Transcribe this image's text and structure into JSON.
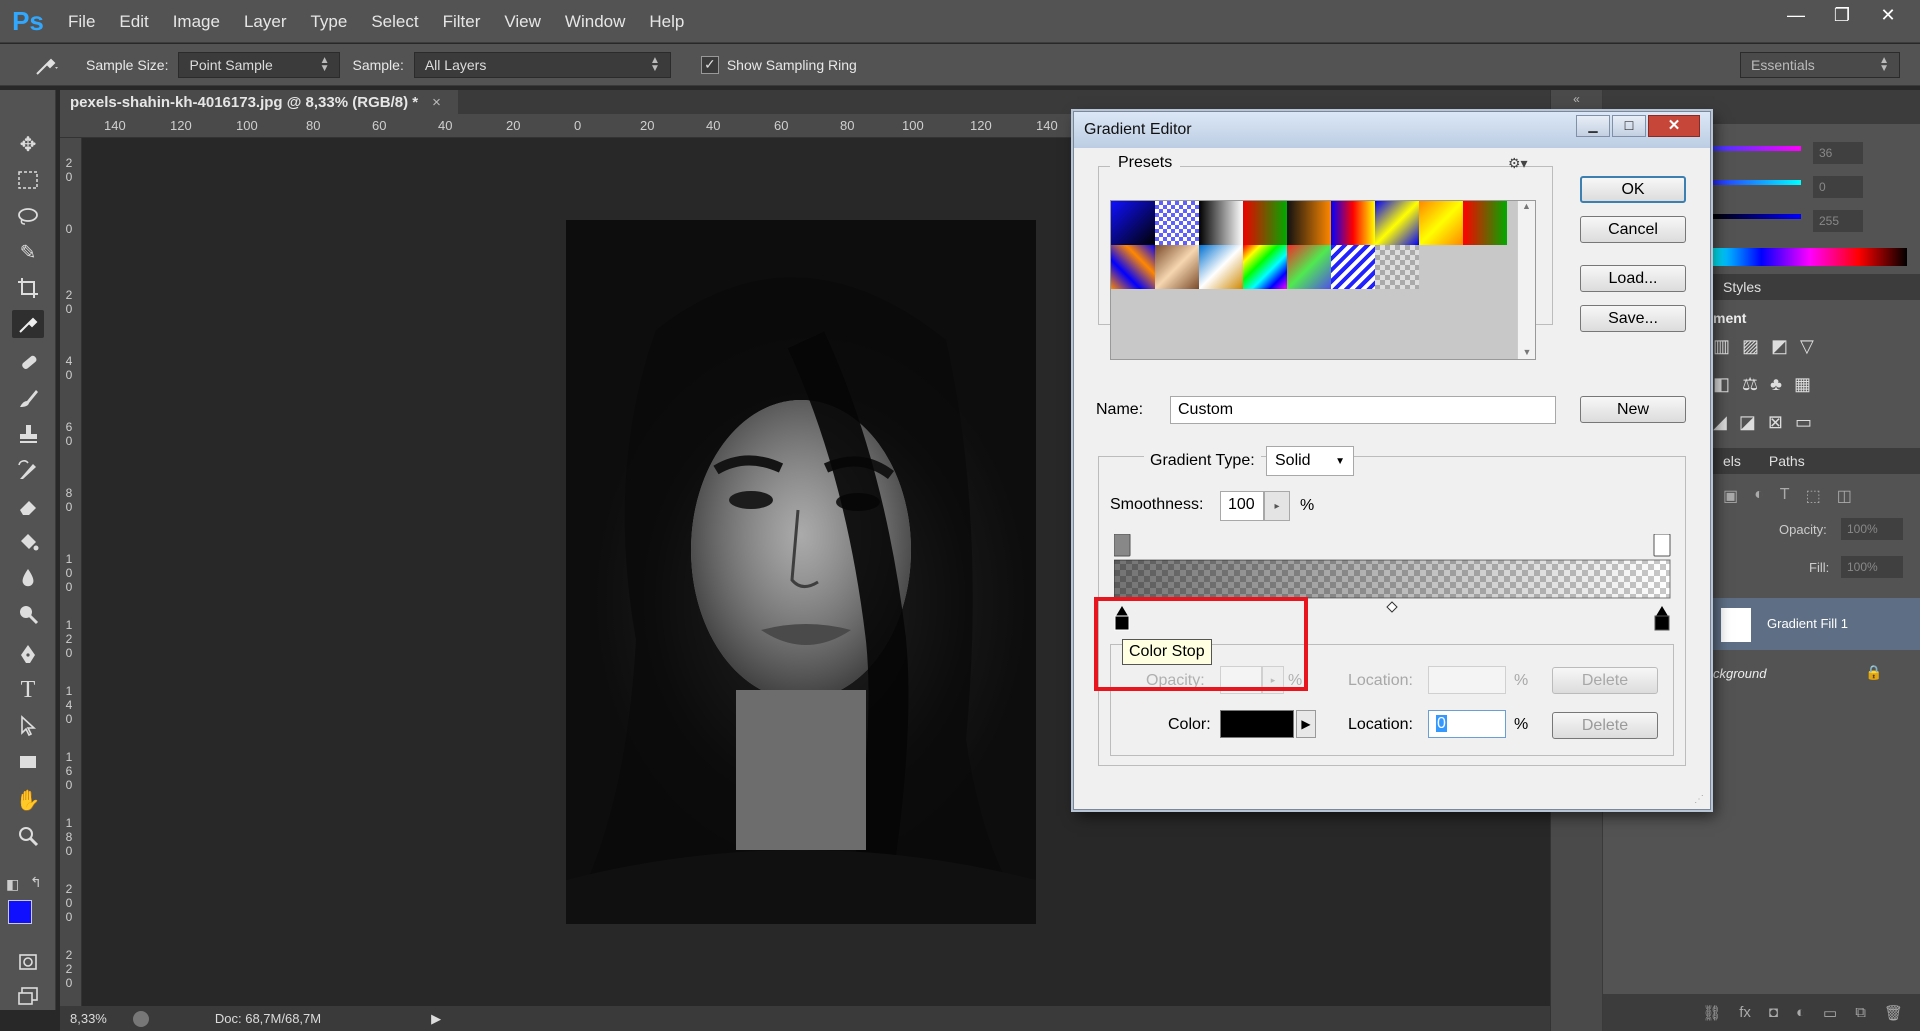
{
  "app": {
    "logo": "Ps"
  },
  "menu": [
    "File",
    "Edit",
    "Image",
    "Layer",
    "Type",
    "Select",
    "Filter",
    "View",
    "Window",
    "Help"
  ],
  "window_controls": {
    "minimize": "—",
    "restore": "❐",
    "close": "✕"
  },
  "options": {
    "sample_size_label": "Sample Size:",
    "sample_size_value": "Point Sample",
    "sample_label": "Sample:",
    "sample_value": "All Layers",
    "show_ring_label": "Show Sampling Ring",
    "show_ring_checked": true,
    "workspace": "Essentials"
  },
  "document": {
    "tab_title": "pexels-shahin-kh-4016173.jpg @ 8,33% (RGB/8) *",
    "tab_close": "×",
    "zoom": "8,33%",
    "doc_info": "Doc: 68,7M/68,7M"
  },
  "ruler": {
    "h_ticks": [
      "140",
      "120",
      "100",
      "80",
      "60",
      "40",
      "20",
      "0",
      "20",
      "40",
      "60",
      "80",
      "100",
      "120",
      "140"
    ],
    "v_ticks": [
      "2 0",
      "0",
      "2 0",
      "4 0",
      "6 0",
      "8 0",
      "1 0 0",
      "1 2 0",
      "1 4 0",
      "1 6 0",
      "1 8 0",
      "2 0 0",
      "2 2 0"
    ]
  },
  "panels": {
    "color_values": [
      "36",
      "0",
      "255"
    ],
    "styles_tab": "Styles",
    "adjustments_label": "ment",
    "layers_tabs": [
      "els",
      "Paths"
    ],
    "opacity_label": "Opacity:",
    "opacity_value": "100%",
    "fill_label": "Fill:",
    "fill_value": "100%",
    "layers": [
      {
        "name": "Gradient Fill 1"
      },
      {
        "name": "ckground"
      }
    ]
  },
  "dialog": {
    "title": "Gradient Editor",
    "presets_label": "Presets",
    "ok": "OK",
    "cancel": "Cancel",
    "load": "Load...",
    "save": "Save...",
    "name_label": "Name:",
    "name_value": "Custom",
    "new": "New",
    "gradient_type_label": "Gradient Type:",
    "gradient_type_value": "Solid",
    "smoothness_label": "Smoothness:",
    "smoothness_value": "100",
    "percent": "%",
    "tooltip": "Color Stop",
    "opacity_label": "Opacity:",
    "location_label": "Location:",
    "delete": "Delete",
    "color_label": "Color:",
    "color_location_value": "0",
    "selected_color": "#000000"
  }
}
